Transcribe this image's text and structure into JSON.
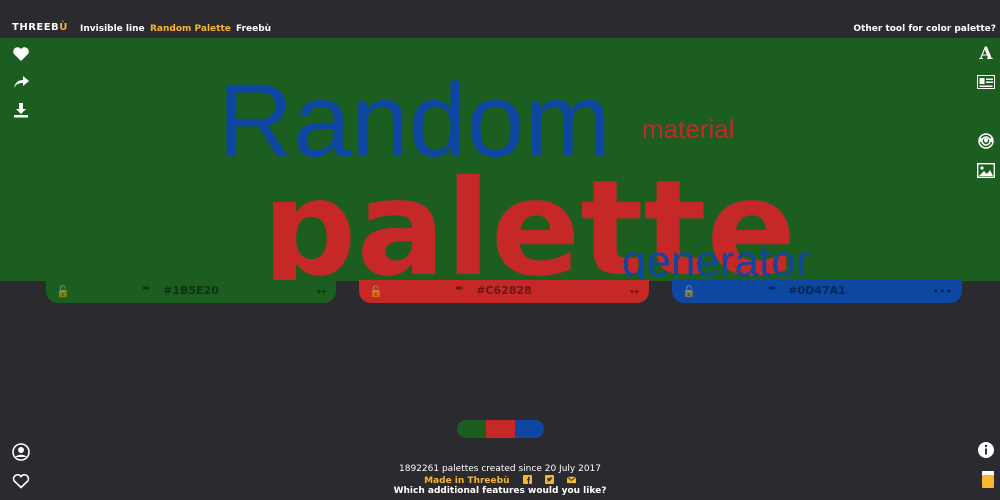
{
  "header": {
    "logo_text": "THREEBÙ",
    "nav": [
      {
        "label": "Invisible line",
        "active": false
      },
      {
        "label": "Random Palette",
        "active": true
      },
      {
        "label": "Freebù",
        "active": false
      }
    ],
    "other_tool": "Other tool for color palette?"
  },
  "hero": {
    "word_random": "Random",
    "word_material": "material",
    "word_palette": "palette",
    "word_generator": "generator"
  },
  "palette": {
    "swatches": [
      {
        "hex": "#1B5E20",
        "color": "#1b5e20"
      },
      {
        "hex": "#C62828",
        "color": "#c62828"
      },
      {
        "hex": "#0D47A1",
        "color": "#0d47a1"
      }
    ]
  },
  "left_toolbar": [
    "heart-icon",
    "share-icon",
    "download-icon"
  ],
  "right_toolbar": [
    "font-icon",
    "card-icon",
    "more-icon",
    "target-icon",
    "image-icon"
  ],
  "footer": {
    "stats": "1892261 palettes created since 20 July 2017",
    "made_in": "Made in Threebù",
    "question": "Which additional features would you like?"
  },
  "colors": {
    "background": "#2b2a2f",
    "accent": "#f5b82e"
  }
}
